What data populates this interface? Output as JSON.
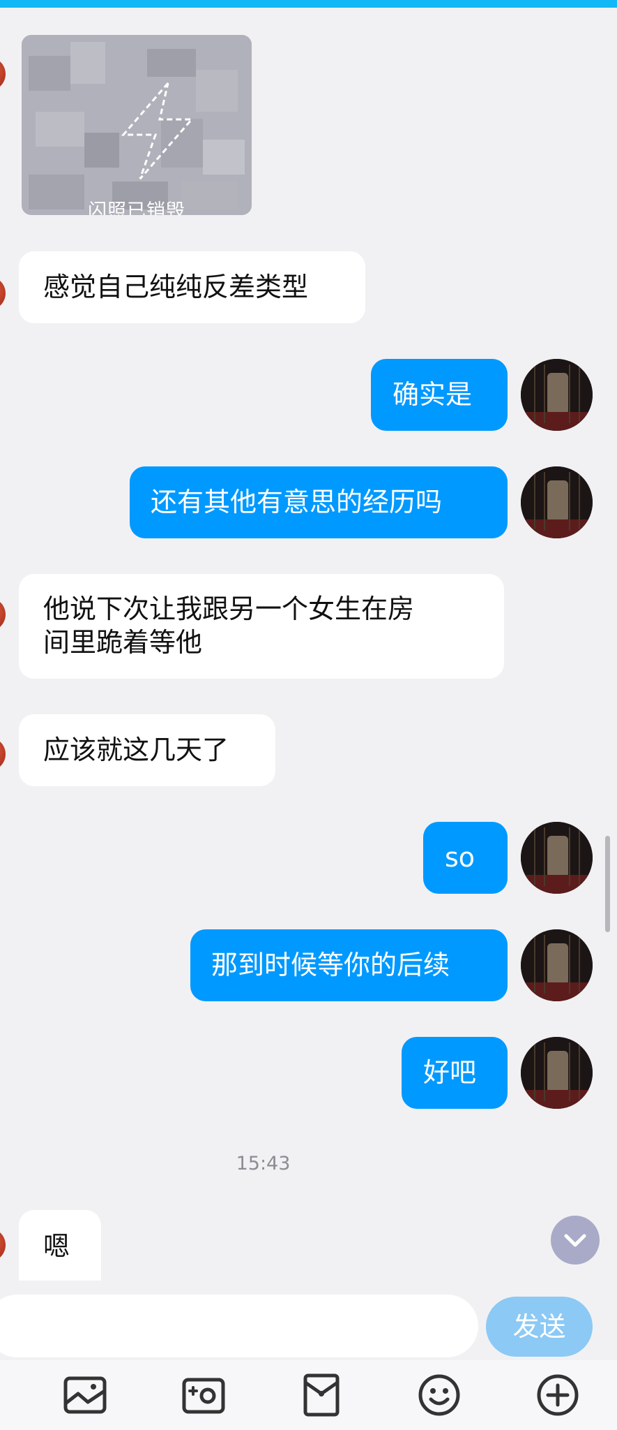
{
  "flash_photo": {
    "label": "闪照已销毁"
  },
  "messages": [
    {
      "side": "in",
      "text": "感觉自己纯纯反差类型"
    },
    {
      "side": "out",
      "text": "确实是"
    },
    {
      "side": "out",
      "text": "还有其他有意思的经历吗"
    },
    {
      "side": "in",
      "line1": "他说下次让我跟另一个女生在房",
      "line2": "间里跪着等他"
    },
    {
      "side": "in",
      "text": "应该就这几天了"
    },
    {
      "side": "out",
      "text": "so"
    },
    {
      "side": "out",
      "text": "那到时候等你的后续"
    },
    {
      "side": "out",
      "text": "好吧"
    },
    {
      "side": "in",
      "text": "嗯"
    }
  ],
  "timestamp": "15:43",
  "input": {
    "send_label": "发送",
    "placeholder": ""
  },
  "toolbar": {
    "icons": [
      "gallery-icon",
      "camera-icon",
      "red-packet-icon",
      "emoji-icon",
      "plus-icon"
    ]
  },
  "colors": {
    "accent": "#0099ff",
    "top_bar": "#12b7f5",
    "send_disabled": "#8cc9f5"
  }
}
